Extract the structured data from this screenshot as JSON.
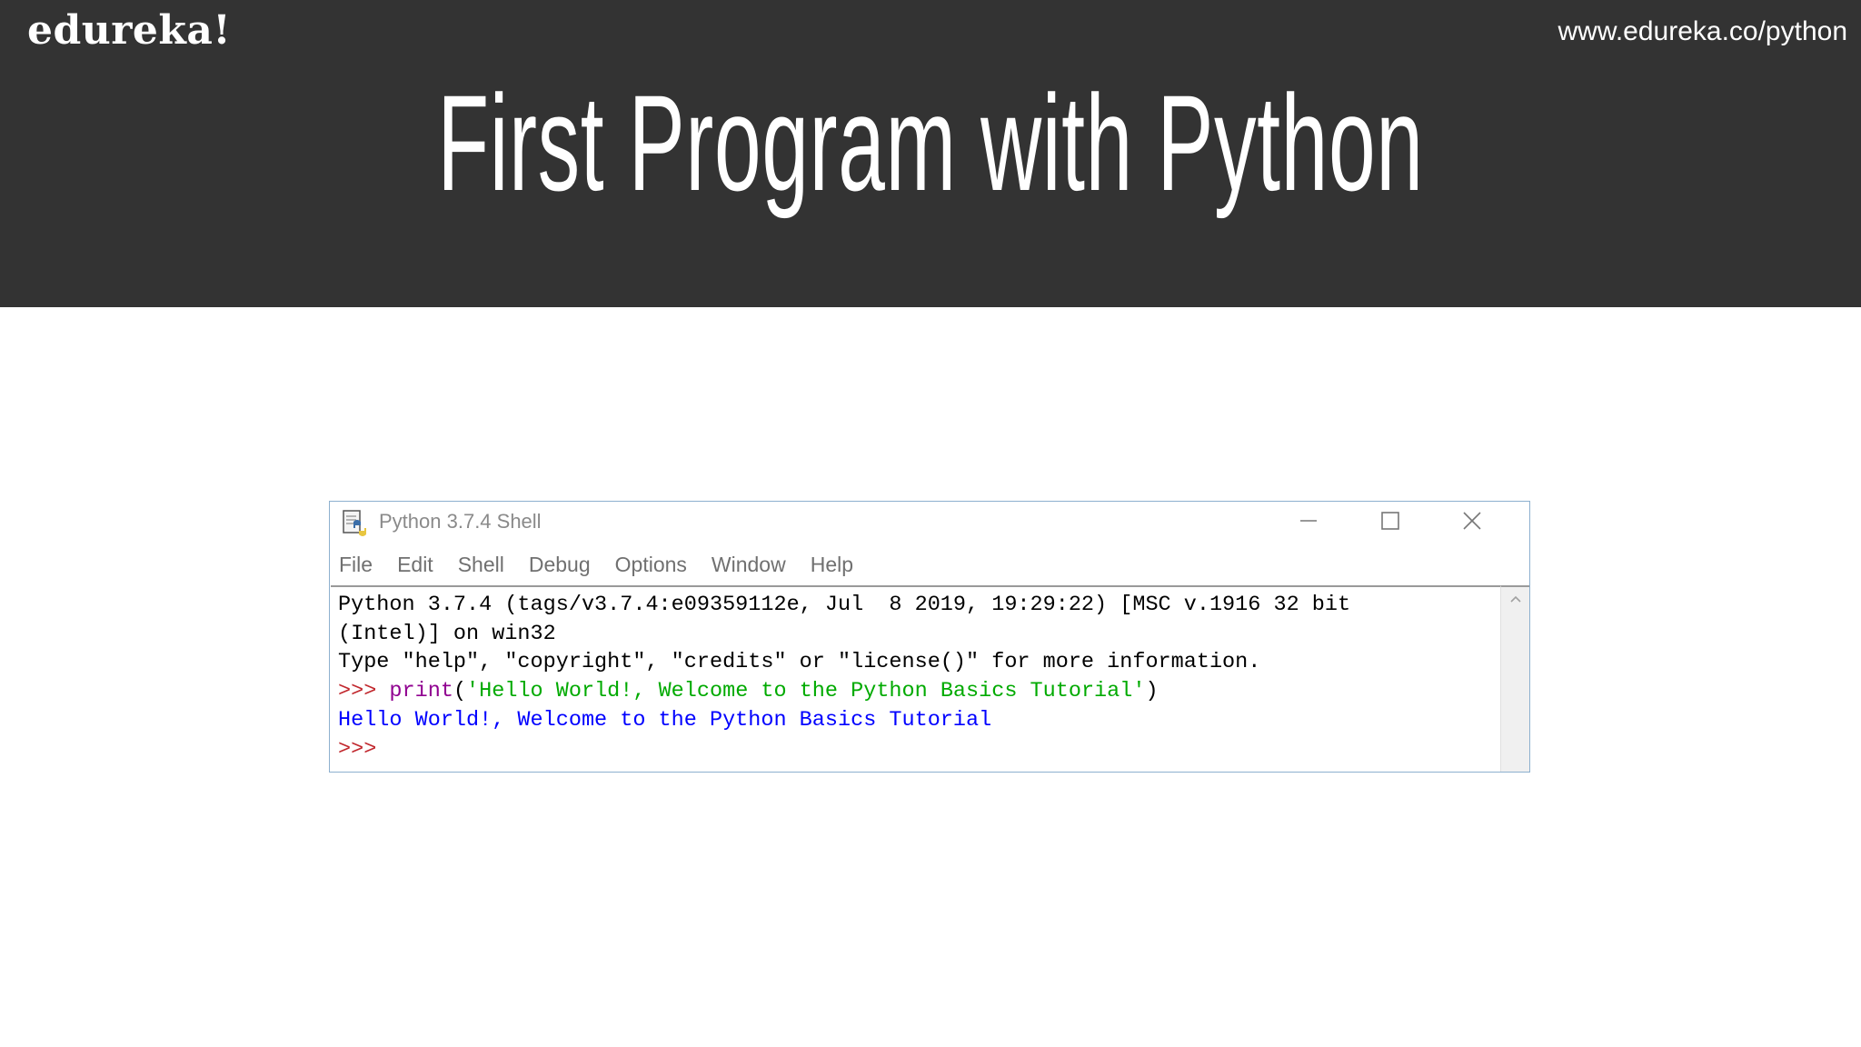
{
  "slide": {
    "brand": "edureka!",
    "url": "www.edureka.co/python",
    "title": "First Program with Python"
  },
  "window": {
    "title": "Python 3.7.4 Shell",
    "menu": [
      "File",
      "Edit",
      "Shell",
      "Debug",
      "Options",
      "Window",
      "Help"
    ]
  },
  "shell": {
    "banner_line1": "Python 3.7.4 (tags/v3.7.4:e09359112e, Jul  8 2019, 19:29:22) [MSC v.1916 32 bit",
    "banner_line2": "(Intel)] on win32",
    "banner_line3": "Type \"help\", \"copyright\", \"credits\" or \"license()\" for more information.",
    "prompt": ">>> ",
    "command_builtin": "print",
    "command_open": "(",
    "command_string": "'Hello World!, Welcome to the Python Basics Tutorial'",
    "command_close": ")",
    "output": "Hello World!, Welcome to the Python Basics Tutorial",
    "final_prompt": ">>>"
  },
  "colors": {
    "header_bg": "#333333",
    "prompt": "#c1272d",
    "builtin": "#900090",
    "string": "#00aa00",
    "output": "#0000ff"
  }
}
